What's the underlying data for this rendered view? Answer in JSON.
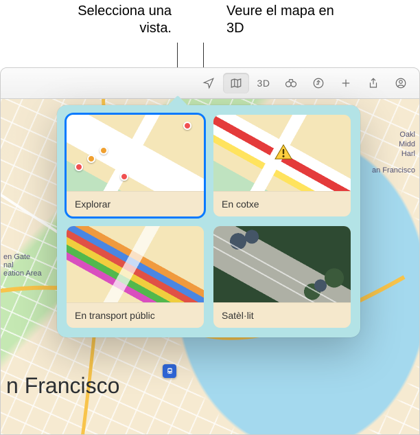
{
  "callouts": {
    "select_view": "Selecciona una vista.",
    "view_3d": "Veure el mapa en 3D"
  },
  "toolbar": {
    "three_d_label": "3D"
  },
  "popover": {
    "views": [
      {
        "key": "explore",
        "label": "Explorar",
        "selected": true
      },
      {
        "key": "drive",
        "label": "En cotxe",
        "selected": false
      },
      {
        "key": "transit",
        "label": "En transport públic",
        "selected": false
      },
      {
        "key": "satellite",
        "label": "Satèl·lit",
        "selected": false
      }
    ]
  },
  "map": {
    "city_label": "n Francisco",
    "labels": {
      "golden_gate": "en Gate\nnal\neation Area",
      "oakland": "Oakl",
      "middle": "Midd",
      "harbor": "Harl",
      "sf_side": "an Francisco"
    }
  }
}
